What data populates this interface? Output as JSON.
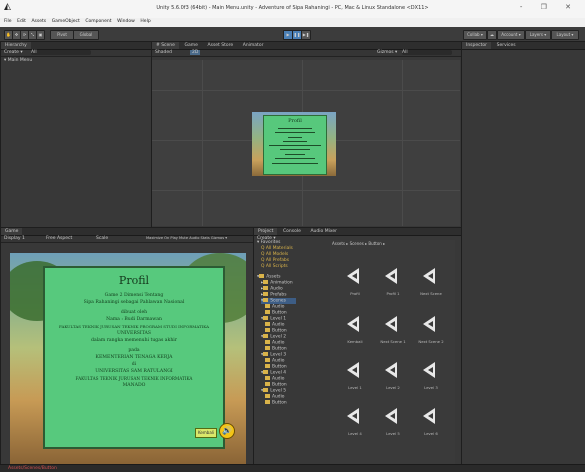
{
  "window": {
    "title": "Unity 5.6.0f3 (64bit) - Main Menu.unity - Adventure of Sipa Rahaningi - PC, Mac & Linux Standalone <DX11>",
    "controls": "- ❐ ✕"
  },
  "menu": [
    "File",
    "Edit",
    "Assets",
    "GameObject",
    "Component",
    "Window",
    "Help"
  ],
  "toolbar": {
    "tools": [
      "✋",
      "✥",
      "⟳",
      "⤡",
      "▣"
    ],
    "pivot": "Pivot",
    "global": "Global",
    "play": "▶",
    "pause": "❚❚",
    "step": "▶❚",
    "collab": "Collab ▾",
    "services": "☁",
    "account": "Account ▾",
    "layers": "Layers ▾",
    "layout": "Layout ▾"
  },
  "hierarchy": {
    "tab": "Hierarchy",
    "create": "Create ▾",
    "search": "All",
    "scene_row": "Main Menu"
  },
  "scene": {
    "tabs": [
      "# Scene",
      "Game",
      "Asset Store",
      "Animator"
    ],
    "shaded": "Shaded",
    "mode_2d": "2D",
    "gizmos": "Gizmos ▾",
    "search": "All"
  },
  "game": {
    "tab": "Game",
    "display": "Display 1",
    "aspect": "Free Aspect",
    "scale": "Scale",
    "options": "Maximize On Play  Mute Audio  Stats  Gizmos ▾"
  },
  "profile": {
    "title": "Profil",
    "lines": [
      "Game 2 Dimensi Tentang",
      "Sipa Rahaningi sebagai Pahlawan Nasional",
      "dibuat oleh",
      "Nama   :   Budi Darmawan",
      "FAKULTAS TEKNIK JURUSAN TEKNIK PROGRAM STUDI INFORMATIKA",
      "UNIVERSITAS",
      "dalam rangka memenuhi tugas akhir",
      "pada",
      "KEMENTERIAN TENAGA KERJA",
      "di",
      "UNIVERSITAS SAM RATULANGI",
      "FAKULTAS TEKNIK JURUSAN TEKNIK INFORMATIKA",
      "MANADO"
    ],
    "back": "Kembali",
    "sound_icon": "speaker-icon"
  },
  "project": {
    "tabs": [
      "Project",
      "Console",
      "Audio Mixer"
    ],
    "create": "Create ▾",
    "favorites": [
      "Favorites",
      "All Materials",
      "All Models",
      "All Prefabs",
      "All Scripts"
    ],
    "tree": [
      "Assets",
      "Animation",
      "Audio",
      "Prefabs",
      "Scenes",
      "Audio",
      "Button",
      "Level 1",
      "Audio",
      "Button",
      "Level 2",
      "Audio",
      "Button",
      "Level 3",
      "Audio",
      "Button",
      "Level 4",
      "Audio",
      "Button",
      "Level 5",
      "Audio",
      "Button"
    ],
    "breadcrumb": "Assets ▸ Scenes ▸ Button ▸",
    "assets": [
      "Profil",
      "Profil 1",
      "Next Scene",
      "Kembali",
      "Next Scene 1",
      "Next Scene 2",
      "Level 1",
      "Level 2",
      "Level 3",
      "Level 4",
      "Level 5",
      "Level 6"
    ]
  },
  "inspector": {
    "tab": "Inspector",
    "services_tab": "Services"
  },
  "status": {
    "message": "Assets/Scenes/Button"
  }
}
